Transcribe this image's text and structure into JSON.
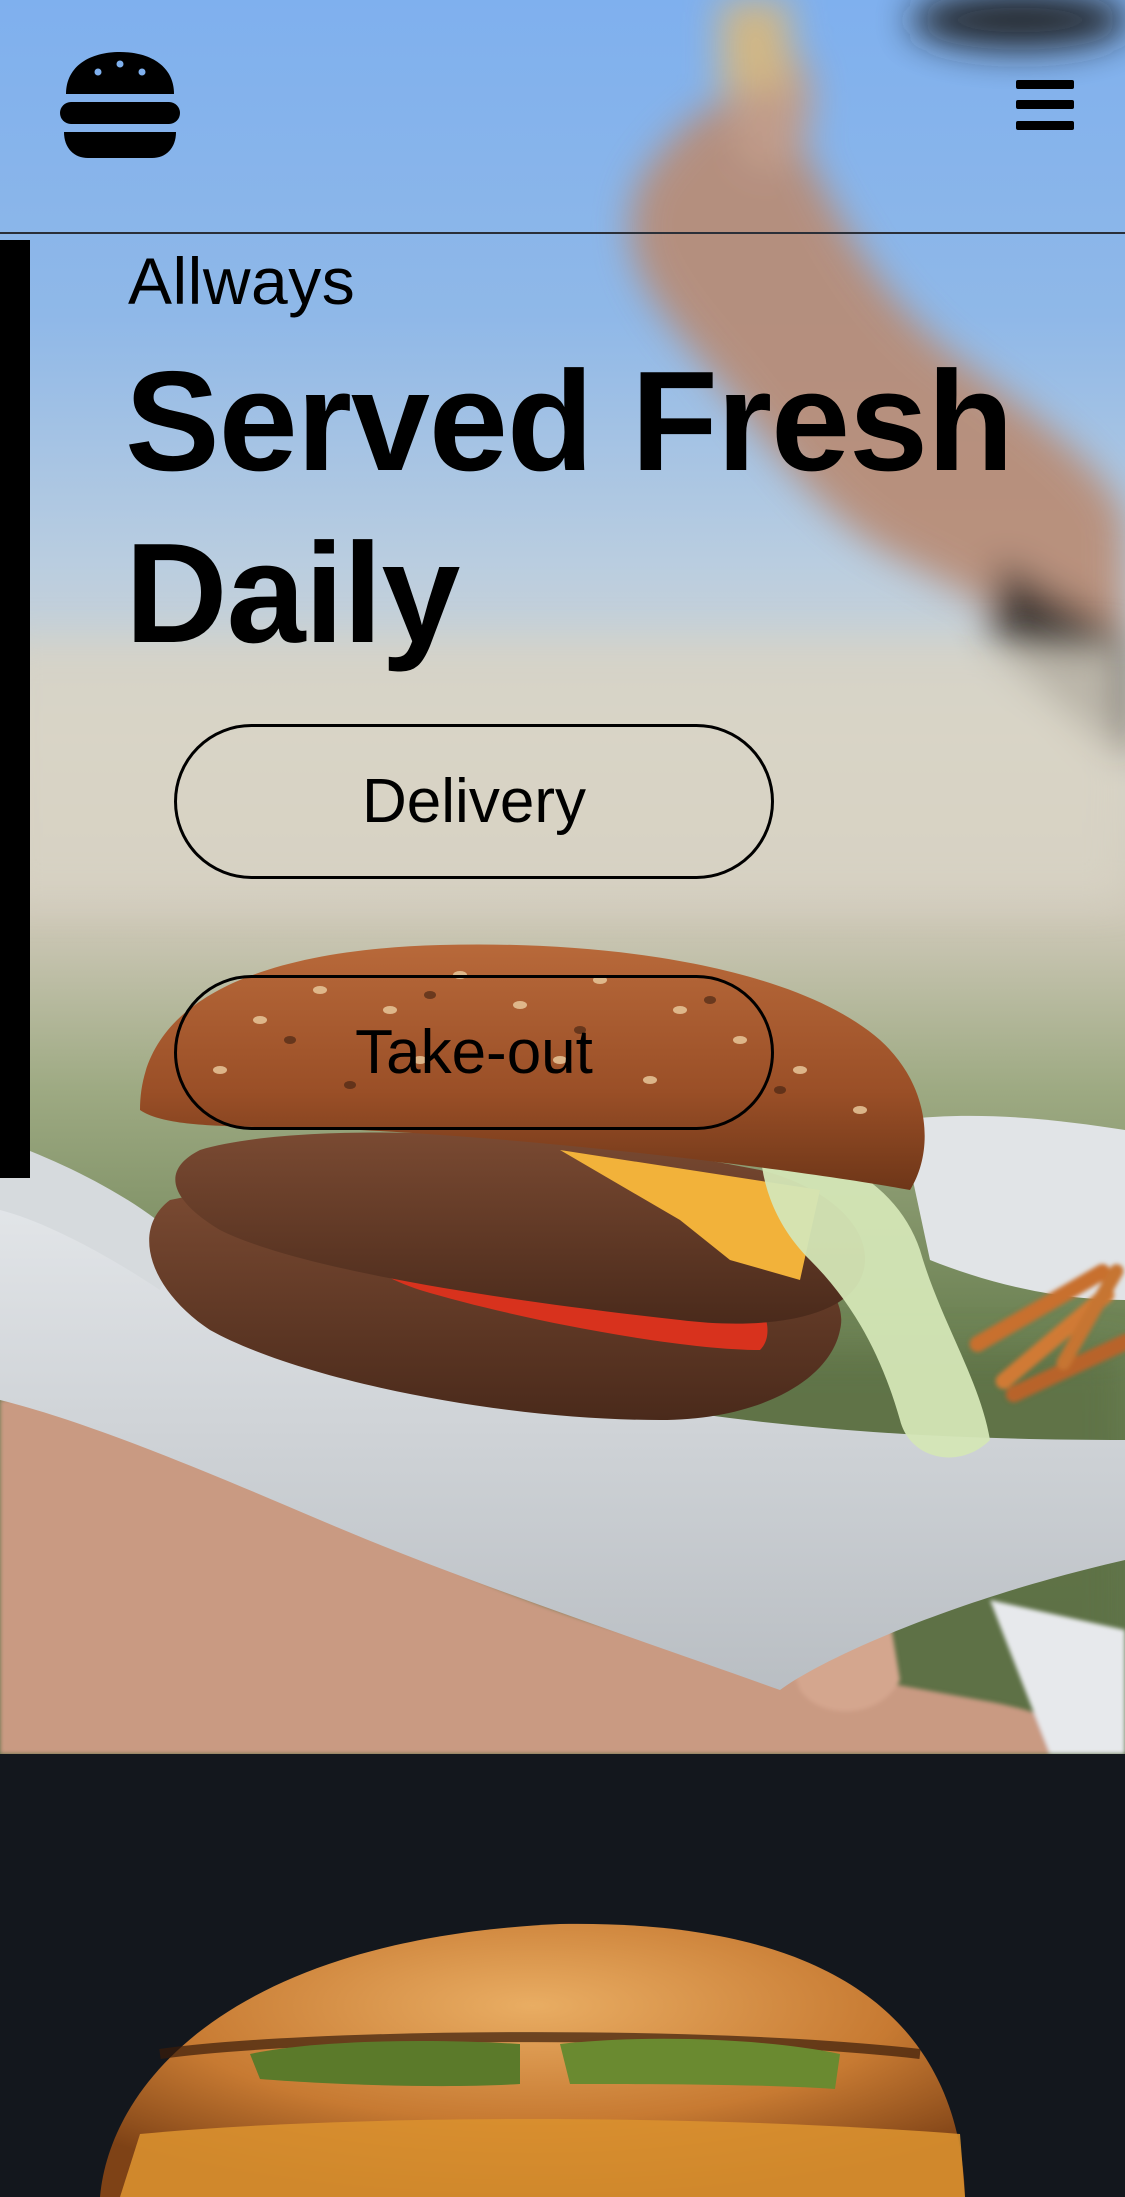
{
  "nav": {
    "logo_icon": "burger-logo-icon",
    "menu_icon": "hamburger-menu-icon"
  },
  "hero": {
    "eyebrow": "Allways",
    "headline": "Served Fresh Daily",
    "buttons": {
      "delivery": "Delivery",
      "takeout": "Take-out"
    }
  },
  "colors": {
    "sky": "#7fb0ee",
    "text": "#000000",
    "dark_section": "#13171d",
    "bun": "#b5642e"
  }
}
